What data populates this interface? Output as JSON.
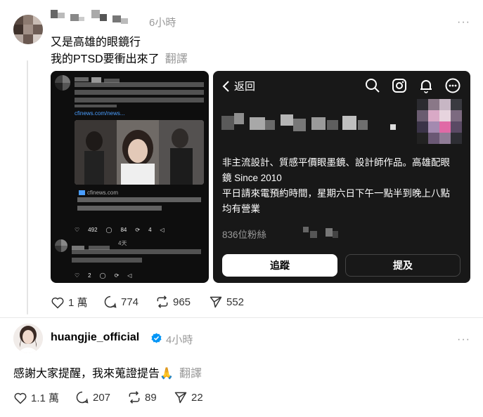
{
  "post1": {
    "time": "6小時",
    "more": "···",
    "line1": "又是高雄的眼鏡行",
    "line2": "我的PTSD要衝出來了",
    "translate": "翻譯",
    "embed_left": {
      "link": "cfinews.com/news...",
      "source": "cfinews.com",
      "stats": {
        "likes": "492",
        "comments": "84",
        "reposts": "4",
        "shares": ""
      },
      "reply_time": "4天",
      "reply_stats": {
        "likes": "2",
        "comments": "",
        "reposts": ""
      }
    },
    "embed_right": {
      "back_label": "返回",
      "bio_line1": "非主流設計、質感平價眼墨鏡、設計師作品。高雄配眼",
      "bio_line2": "鏡 Since 2010",
      "bio_line3": "平日請來電預約時間，星期六日下午一點半到晚上八點",
      "bio_line4": "均有營業",
      "followers": "836位粉絲",
      "follow_label": "追蹤",
      "mention_label": "提及"
    },
    "actions": {
      "likes": "1 萬",
      "comments": "774",
      "reposts": "965",
      "shares": "552"
    }
  },
  "post2": {
    "username": "huangjie_official",
    "time": "4小時",
    "more": "···",
    "text": "感謝大家提醒，我來蒐證提告🙏",
    "translate": "翻譯",
    "actions": {
      "likes": "1.1 萬",
      "comments": "207",
      "reposts": "89",
      "shares": "22"
    }
  },
  "colors": {
    "muted": "#999999",
    "verified": "#0095f6",
    "card_dark": "#181818"
  }
}
